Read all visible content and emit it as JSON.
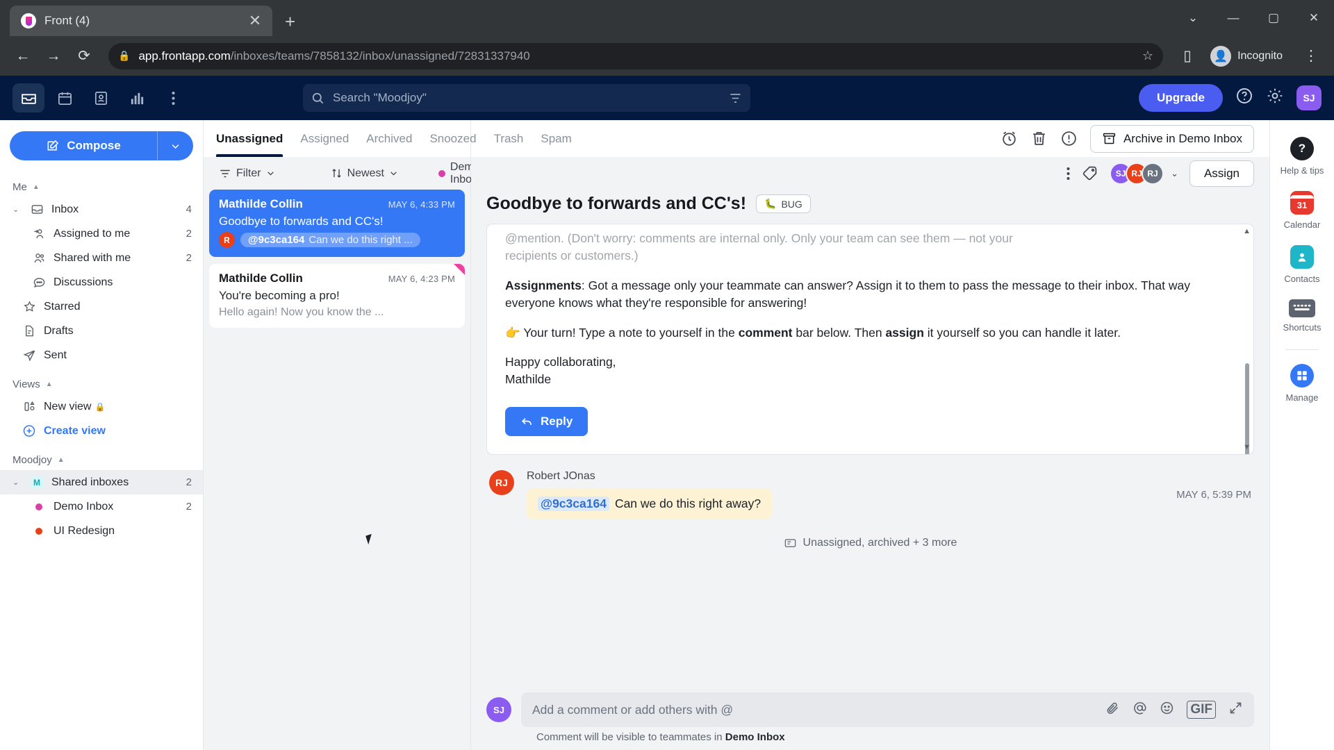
{
  "browser": {
    "tab_title": "Front (4)",
    "tab_close": "✕",
    "new_tab": "+",
    "minimize": "—",
    "maximize": "▢",
    "close": "✕",
    "caret_down": "⌄",
    "back": "←",
    "forward": "→",
    "reload": "⟳",
    "lock": "🔒",
    "url_host": "app.frontapp.com",
    "url_path": "/inboxes/teams/7858132/inbox/unassigned/72831337940",
    "star": "☆",
    "sidepanel": "▯",
    "incognito_label": "Incognito",
    "incognito_avatar": "👤",
    "menu": "⋮"
  },
  "topbar": {
    "icons": [
      "inbox-icon",
      "calendar-icon",
      "contacts-icon",
      "analytics-icon",
      "more-icon"
    ],
    "search_placeholder": "Search \"Moodjoy\"",
    "search_icon": "search-icon",
    "filter_icon": "filter-icon",
    "upgrade_label": "Upgrade",
    "help_icon": "?",
    "settings_icon": "⚙",
    "avatar_initials": "SJ",
    "accent": "#4b5cf0"
  },
  "sidebar": {
    "compose_label": "Compose",
    "sections": [
      {
        "title": "Me",
        "items": [
          {
            "label": "Inbox",
            "count": "4",
            "icon": "inbox-icon",
            "chevron": "⌄",
            "indent": 0
          },
          {
            "label": "Assigned to me",
            "count": "2",
            "icon": "assigned-user-icon",
            "indent": 1
          },
          {
            "label": "Shared with me",
            "count": "2",
            "icon": "shared-users-icon",
            "indent": 1
          },
          {
            "label": "Discussions",
            "count": "",
            "icon": "discussion-icon",
            "indent": 1
          },
          {
            "label": "Starred",
            "count": "",
            "icon": "star-icon",
            "indent": 0
          },
          {
            "label": "Drafts",
            "count": "",
            "icon": "drafts-icon",
            "indent": 0
          },
          {
            "label": "Sent",
            "count": "",
            "icon": "sent-icon",
            "indent": 0
          }
        ]
      },
      {
        "title": "Views",
        "items": [
          {
            "label": "New view",
            "count": "",
            "icon": "view-icon",
            "locked": true,
            "indent": 0
          },
          {
            "label": "Create view",
            "count": "",
            "icon": "plus-circle-icon",
            "accent": true,
            "indent": 0
          }
        ]
      },
      {
        "title": "Moodjoy",
        "items": [
          {
            "label": "Shared inboxes",
            "count": "2",
            "icon": "moodjoy-badge",
            "chevron": "⌄",
            "selected": true,
            "indent": 0
          },
          {
            "label": "Demo Inbox",
            "count": "2",
            "icon": "dot",
            "color": "#d93fa8",
            "indent": 1
          },
          {
            "label": "UI Redesign",
            "count": "",
            "icon": "dot",
            "color": "#e8401a",
            "indent": 1
          }
        ]
      }
    ]
  },
  "conversation_list": {
    "tabs": [
      {
        "label": "Unassigned",
        "active": true
      },
      {
        "label": "Assigned",
        "active": false
      },
      {
        "label": "Archived",
        "active": false
      },
      {
        "label": "Snoozed",
        "active": false
      },
      {
        "label": "Trash",
        "active": false
      },
      {
        "label": "Spam",
        "active": false
      }
    ],
    "filter_label": "Filter",
    "sort_label": "Newest",
    "inbox_label": "Demo Inbox",
    "inbox_dot_color": "#d93fa8",
    "items": [
      {
        "from": "Mathilde Collin",
        "date": "MAY 6, 4:33 PM",
        "subject": "Goodbye to forwards and CC's!",
        "preview_mention": "@9c3ca164",
        "preview_text": "Can we do this right ...",
        "avatar": "R",
        "selected": true
      },
      {
        "from": "Mathilde Collin",
        "date": "MAY 6, 4:23 PM",
        "subject": "You're becoming a pro!",
        "preview_text": "Hello again! Now you know the ...",
        "selected": false,
        "flag": true
      }
    ]
  },
  "message": {
    "toolbar": {
      "snooze_icon": "clock-icon",
      "trash_icon": "trash-icon",
      "spam_icon": "alert-icon",
      "archive_label": "Archive in Demo Inbox",
      "archive_icon": "archive-icon"
    },
    "more_icon": "⋮",
    "tag_add_icon": "tag-icon",
    "assignees": [
      {
        "initials": "SJ",
        "color": "#8a5cf0"
      },
      {
        "initials": "RJ",
        "color": "#e8401a"
      },
      {
        "initials": "RJ",
        "color": "#6b7280"
      }
    ],
    "assignee_caret": "⌄",
    "assign_label": "Assign",
    "subject": "Goodbye to forwards and CC's!",
    "tag_label": "BUG",
    "tag_emoji": "🐛",
    "body": {
      "faded_line1": "@mention. (Don't worry: comments are internal only. Only your team can see them — not your",
      "faded_line2": "recipients or customers.)",
      "para_assignments_label": "Assignments",
      "para_assignments": ": Got a message only your teammate can answer? Assign it to them to pass the message to their inbox. That way everyone knows what they're responsible for answering!",
      "para_turn_prefix": "👉 Your turn! Type a note to yourself in the ",
      "para_turn_bold1": "comment",
      "para_turn_mid": " bar below. Then ",
      "para_turn_bold2": "assign",
      "para_turn_suffix": " it yourself so you can handle it later.",
      "signoff_line1": "Happy collaborating,",
      "signoff_line2": "Mathilde",
      "reply_label": "Reply",
      "reply_icon": "reply-arrow-icon"
    },
    "comment": {
      "author": "Robert JOnas",
      "avatar": "RJ",
      "mention": "@9c3ca164",
      "text": "Can we do this right away?",
      "time": "MAY 6, 5:39 PM"
    },
    "system_line": "Unassigned, archived + 3 more",
    "system_icon": "activity-icon",
    "composer": {
      "avatar": "SJ",
      "placeholder": "Add a comment or add others with @",
      "icons": [
        "attachment-icon",
        "mention-icon",
        "emoji-icon",
        "gif-icon",
        "expand-icon"
      ],
      "gif_label": "GIF",
      "note_prefix": "Comment will be visible to teammates in ",
      "note_bold": "Demo Inbox"
    }
  },
  "right_rail": {
    "items": [
      {
        "label": "Help & tips",
        "icon": "help-icon",
        "glyph": "?",
        "color": "#1d2127"
      },
      {
        "label": "Calendar",
        "icon": "calendar-icon",
        "glyph": "31",
        "color": "#e8392f"
      },
      {
        "label": "Contacts",
        "icon": "contacts-icon",
        "glyph": "👤",
        "color": "#1fb6c9"
      },
      {
        "label": "Shortcuts",
        "icon": "keyboard-icon",
        "glyph": "⌨",
        "color": "#5d6470"
      },
      {
        "label": "Manage",
        "icon": "manage-grid-icon",
        "glyph": "▦",
        "color": "#3478f6"
      }
    ]
  }
}
